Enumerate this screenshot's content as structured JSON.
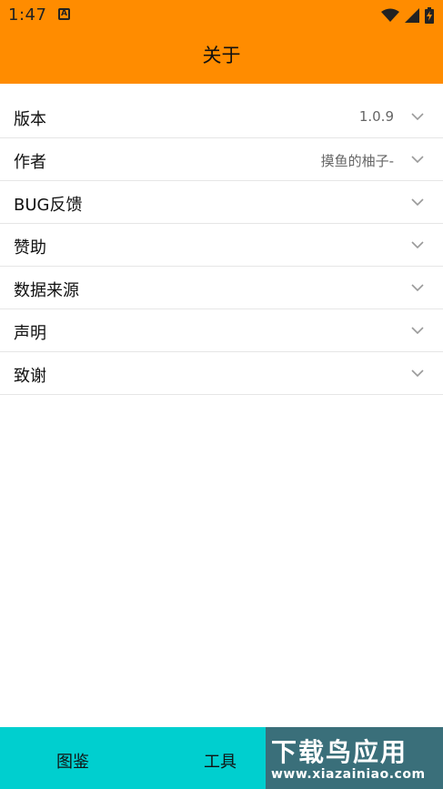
{
  "status": {
    "time": "1:47",
    "notif_glyph": "A",
    "icons": [
      "wifi-icon",
      "signal-icon",
      "battery-charging-icon"
    ]
  },
  "appbar": {
    "title": "关于"
  },
  "colors": {
    "accent": "#FF8C00",
    "bottom_nav": "#00CFCF",
    "divider": "#E6E6E6"
  },
  "list": {
    "items": [
      {
        "label": "版本",
        "value": "1.0.9"
      },
      {
        "label": "作者",
        "value": "摸鱼的柚子-"
      },
      {
        "label": "BUG反馈",
        "value": ""
      },
      {
        "label": "赞助",
        "value": ""
      },
      {
        "label": "数据来源",
        "value": ""
      },
      {
        "label": "声明",
        "value": ""
      },
      {
        "label": "致谢",
        "value": ""
      }
    ]
  },
  "bottom_nav": {
    "tabs": [
      {
        "label": "图鉴"
      },
      {
        "label": "工具"
      }
    ]
  },
  "watermark": {
    "top_text": "下载鸟应用",
    "bottom_text": "www.xiazainiao.com"
  }
}
